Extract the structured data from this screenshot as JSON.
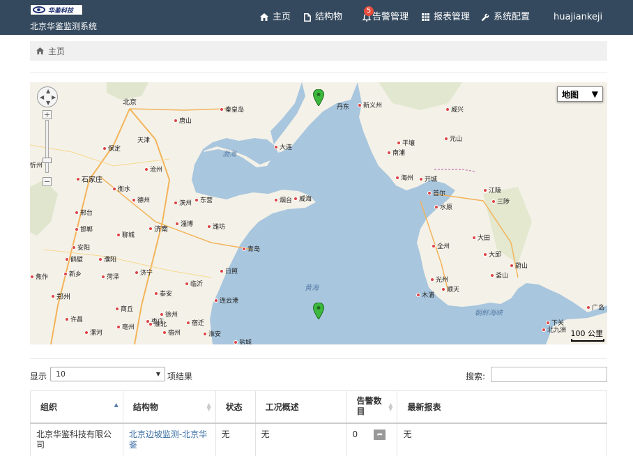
{
  "brand": {
    "logo_text": "华鉴科技",
    "system_name": "北京华鉴监测系统"
  },
  "nav": {
    "home": "主页",
    "structures": "结构物",
    "alarms": "告警管理",
    "alarm_badge": "5",
    "reports": "报表管理",
    "settings": "系统配置",
    "user": "huajiankeji"
  },
  "breadcrumb": {
    "home": "主页"
  },
  "map": {
    "type_selected": "地图",
    "scale_label": "100 公里",
    "seas": [
      "渤海",
      "黄海",
      "朝鲜海峡"
    ],
    "cities": [
      "北京",
      "天津",
      "秦皇岛",
      "唐山",
      "保定",
      "廊坊",
      "沧州",
      "石家庄",
      "衡水",
      "德州",
      "邢台",
      "邯郸",
      "聊城",
      "济南",
      "淄博",
      "潍坊",
      "青岛",
      "烟台",
      "威海",
      "东营",
      "滨州",
      "安阳",
      "鹤壁",
      "濮阳",
      "焦作",
      "新乡",
      "郑州",
      "许昌",
      "菏泽",
      "济宁",
      "泰安",
      "临沂",
      "日照",
      "枣庄",
      "商丘",
      "徐州",
      "连云港",
      "宿迁",
      "淮北",
      "亳州",
      "宿州",
      "漯河",
      "淮安",
      "盐城",
      "长治",
      "阳泉",
      "忻州",
      "大连",
      "丹东",
      "新义州",
      "平壤",
      "南浦",
      "海州",
      "开城",
      "首尔",
      "水原",
      "大田",
      "全州",
      "光州",
      "大邱",
      "蔚山",
      "釜山",
      "木浦",
      "顺天",
      "江陵",
      "三陟",
      "元山",
      "咸兴",
      "威兴",
      "下关",
      "北九洲",
      "广岛"
    ]
  },
  "table_controls": {
    "show_label": "显示",
    "page_size": "10",
    "suffix_label": "项结果",
    "search_label": "搜索:"
  },
  "table": {
    "headers": [
      "组织",
      "结构物",
      "状态",
      "工况概述",
      "告警数目",
      "最新报表"
    ],
    "rows": [
      {
        "org": "北京华鉴科技有限公司",
        "structure": "北京边坡监测-北京华鉴",
        "status": "无",
        "condition": "无",
        "alarm_count": "0",
        "report": "无"
      }
    ]
  }
}
